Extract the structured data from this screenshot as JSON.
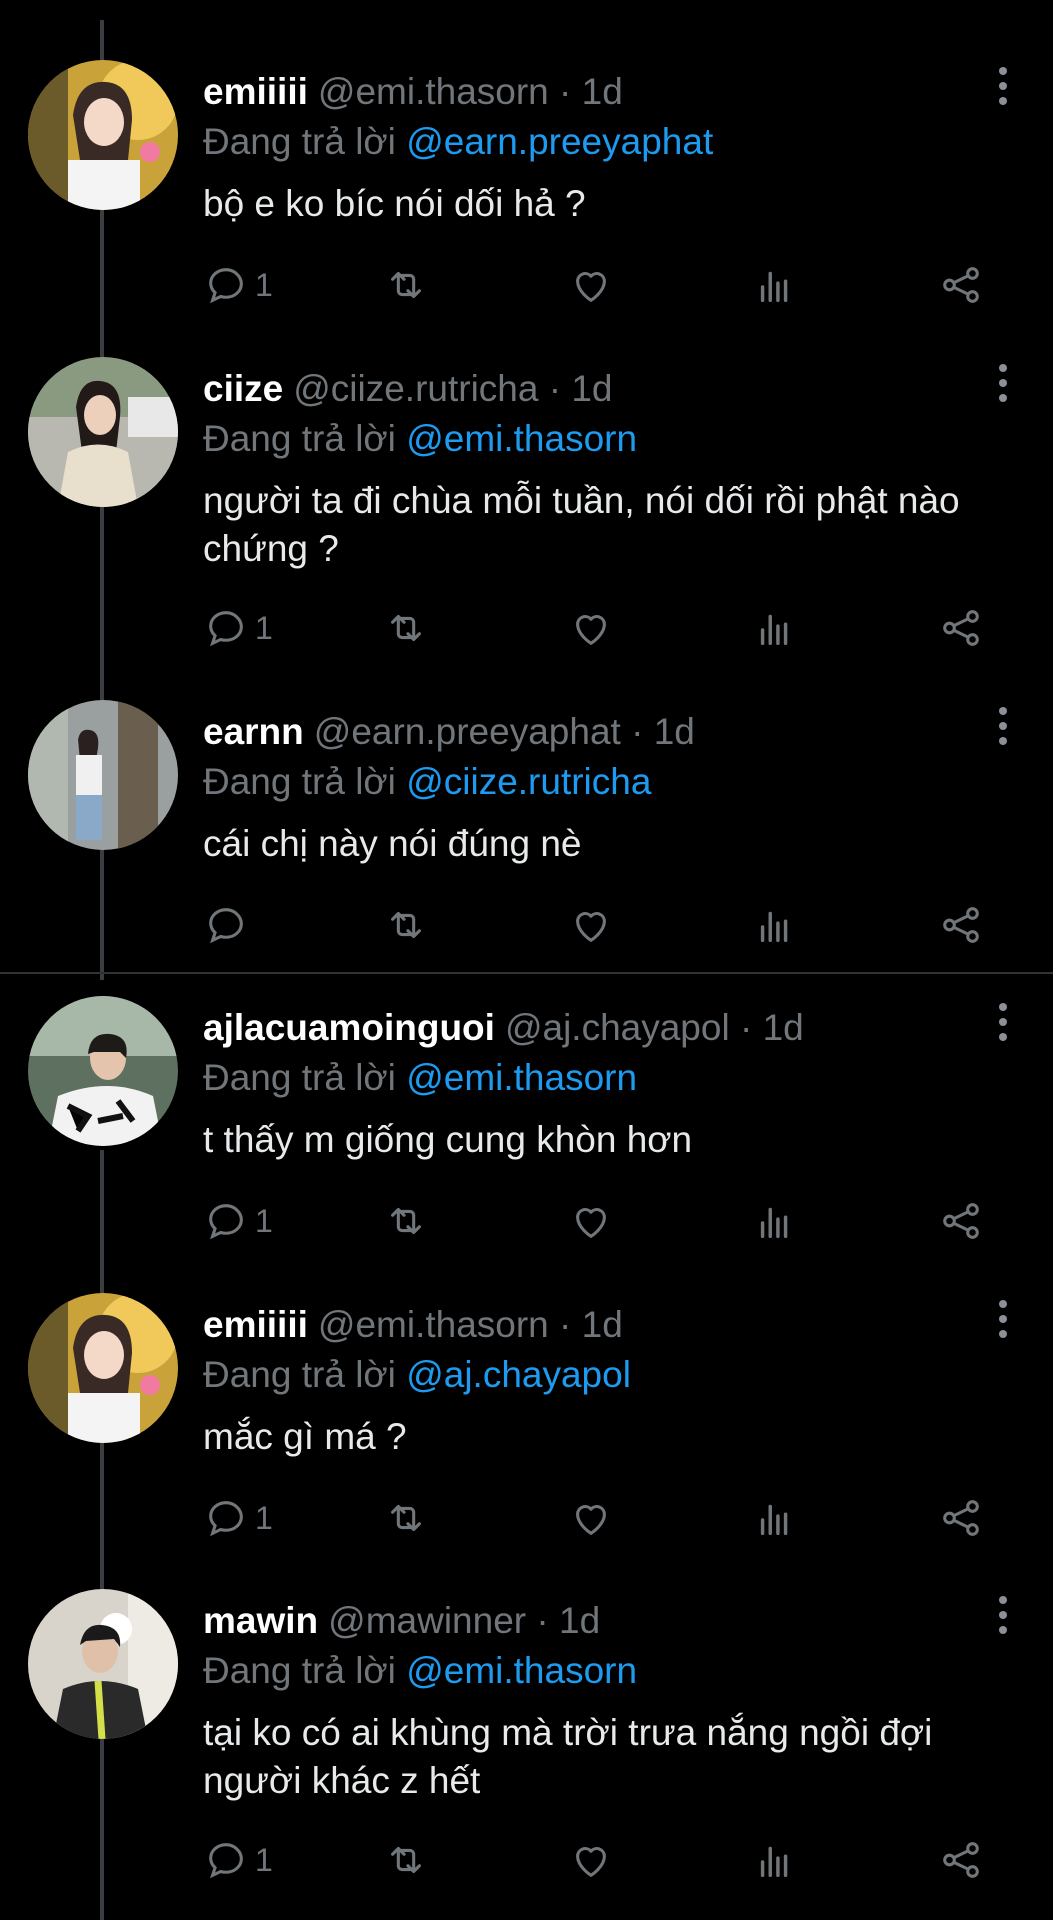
{
  "tweets": [
    {
      "name": "emiiiii",
      "handle": "@emi.thasorn",
      "dot": "·",
      "time": "1d",
      "reply_prefix": "Đang trả lời ",
      "reply_to": "@earn.preeyaphat",
      "text": "bộ e ko bíc nói dối hả ?",
      "reply_count": "1"
    },
    {
      "name": "ciize",
      "handle": "@ciize.rutricha",
      "dot": "·",
      "time": "1d",
      "reply_prefix": "Đang trả lời ",
      "reply_to": "@emi.thasorn",
      "text": "người ta đi chùa mỗi tuần, nói dối rồi phật nào chứng ?",
      "reply_count": "1"
    },
    {
      "name": "earnn",
      "handle": "@earn.preeyaphat",
      "dot": "·",
      "time": "1d",
      "reply_prefix": "Đang trả lời ",
      "reply_to": "@ciize.rutricha",
      "text": "cái chị này nói đúng nè",
      "reply_count": ""
    },
    {
      "name": "ajlacuamoinguoi",
      "handle": "@aj.chayapol",
      "dot": "·",
      "time": "1d",
      "reply_prefix": "Đang trả lời ",
      "reply_to": "@emi.thasorn",
      "text": "t thấy m giống cung khòn hơn",
      "reply_count": "1"
    },
    {
      "name": "emiiiii",
      "handle": "@emi.thasorn",
      "dot": "·",
      "time": "1d",
      "reply_prefix": "Đang trả lời ",
      "reply_to": "@aj.chayapol",
      "text": "mắc gì má ?",
      "reply_count": "1"
    },
    {
      "name": "mawin",
      "handle": "@mawinner",
      "dot": "·",
      "time": "1d",
      "reply_prefix": "Đang trả lời ",
      "reply_to": "@emi.thasorn",
      "text": "tại ko có ai khùng mà trời trưa nắng ngồi đợi người khác z hết",
      "reply_count": "1"
    }
  ],
  "icons": {
    "reply": "reply-icon",
    "retweet": "retweet-icon",
    "like": "heart-icon",
    "stats": "stats-icon",
    "share": "share-icon",
    "more": "more-vertical-icon"
  },
  "colors": {
    "background": "#000000",
    "text": "#e7e9ea",
    "muted": "#71767b",
    "mention": "#1d9bf0",
    "thread_line": "#3a3d42"
  }
}
